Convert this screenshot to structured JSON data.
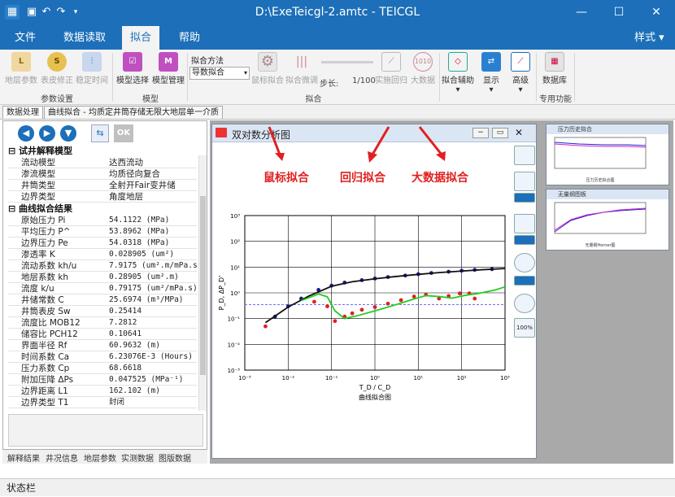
{
  "titlebar": {
    "title": "D:\\ExeTeicgl-2.amtc - TEICGL",
    "minimize": "—",
    "maximize": "☐",
    "close": "✕"
  },
  "menu": {
    "tabs": [
      "文件",
      "数据读取",
      "拟合",
      "帮助"
    ],
    "style": "样式"
  },
  "ribbon": {
    "params_group": {
      "label": "参数设置",
      "buttons": [
        "地层参数",
        "表皮修正",
        "稳定时间"
      ]
    },
    "model_group": {
      "label": "模型",
      "buttons": [
        "模型选择",
        "模型管理"
      ]
    },
    "fit_group": {
      "label": "拟合",
      "method_label": "拟合方法",
      "method_value": "导数拟合",
      "buttons": [
        "鼠标拟合",
        "拟合微调"
      ],
      "step_label": "步长:",
      "step_value": "1/100",
      "buttons2": [
        "实施回归",
        "大数据"
      ]
    },
    "assist": "拟合辅助",
    "display": "显示",
    "advanced": "高级",
    "database_group": {
      "label": "专用功能",
      "button": "数据库"
    }
  },
  "doc_tabs": [
    "数据处理",
    "曲线拟合 - 均质定井筒存储无限大地层单一介质"
  ],
  "left_panel": {
    "ok_label": "OK",
    "group1": "试井解释模型",
    "model_rows": [
      {
        "k": "流动模型",
        "v": "达西流动"
      },
      {
        "k": "渗流模型",
        "v": "均质径向复合"
      },
      {
        "k": "井筒类型",
        "v": "全射开Fair变井储"
      },
      {
        "k": "边界类型",
        "v": "角度地层"
      }
    ],
    "group2": "曲线拟合结果",
    "result_rows": [
      {
        "k": "原始压力 Pi",
        "v": "54.1122 (MPa)"
      },
      {
        "k": "平均压力 P^",
        "v": "53.8962 (MPa)"
      },
      {
        "k": "边界压力 Pe",
        "v": "54.0318 (MPa)"
      },
      {
        "k": "渗透率 K",
        "v": "0.028905 (um²)"
      },
      {
        "k": "流动系数 kh/u",
        "v": "7.9175 (um².m/mPa.s"
      },
      {
        "k": "地层系数 kh",
        "v": "0.28905 (um².m)"
      },
      {
        "k": "流度 k/u",
        "v": "0.79175 (um²/mPa.s)"
      },
      {
        "k": "井储常数 C",
        "v": "25.6974 (m³/MPa)"
      },
      {
        "k": "井筒表皮 Sw",
        "v": "0.25414"
      },
      {
        "k": "流度比 MOB12",
        "v": "7.2812"
      },
      {
        "k": "储容比 PCH12",
        "v": "0.10641"
      },
      {
        "k": "界面半径 Rf",
        "v": "60.9632 (m)"
      },
      {
        "k": "时间系数 Ca",
        "v": "6.23076E-3 (Hours)"
      },
      {
        "k": "压力系数 Cp",
        "v": "68.6618"
      },
      {
        "k": "附加压降 ΔPs",
        "v": "0.047525 (MPa⁻¹)"
      },
      {
        "k": "边界距离 L1",
        "v": "162.102 (m)"
      },
      {
        "k": "边界类型 T1",
        "v": "封闭"
      }
    ],
    "bottom_tabs": [
      "解释结果",
      "井况信息",
      "地层参数",
      "实测数据",
      "图版数据"
    ]
  },
  "chart_window": {
    "title": "双对数分析图"
  },
  "chart_data": {
    "type": "scatter",
    "xlabel": "T_D / C_D",
    "ylabel": "P_D, ΔP_D'",
    "caption": "曲线拟合图",
    "x_scale": "log",
    "y_scale": "log",
    "xlim": [
      0.001,
      1000
    ],
    "ylim": [
      0.001,
      1000
    ],
    "x_ticks": [
      "10⁻³",
      "10⁻²",
      "10⁻¹",
      "10⁰",
      "10¹",
      "10²",
      "10³"
    ],
    "y_ticks": [
      "10⁻³",
      "10⁻²",
      "10⁻¹",
      "10⁰",
      "10¹",
      "10²",
      "10³"
    ],
    "reference_line_y": 0.35,
    "series": [
      {
        "color": "#1b1b8f",
        "kind": "points",
        "x": [
          0.005,
          0.01,
          0.02,
          0.05,
          0.1,
          0.2,
          0.5,
          1,
          2,
          5,
          10,
          20,
          50,
          100,
          200,
          500
        ],
        "y": [
          0.12,
          0.3,
          0.6,
          1.3,
          1.9,
          2.5,
          3.1,
          3.6,
          4.1,
          4.7,
          5.3,
          5.9,
          6.6,
          7.2,
          7.8,
          8.3
        ]
      },
      {
        "color": "#111111",
        "kind": "line",
        "x": [
          0.003,
          0.01,
          0.03,
          0.1,
          0.3,
          1,
          3,
          10,
          30,
          100,
          300,
          1000
        ],
        "y": [
          0.07,
          0.28,
          0.75,
          1.8,
          2.7,
          3.5,
          4.3,
          5.2,
          6.1,
          7.0,
          7.9,
          8.8
        ]
      },
      {
        "color": "#e02020",
        "kind": "points",
        "x": [
          0.003,
          0.04,
          0.08,
          0.12,
          0.2,
          0.3,
          0.5,
          1,
          2,
          4,
          8,
          15,
          30,
          50,
          90,
          150,
          200
        ],
        "y": [
          0.05,
          0.45,
          0.3,
          0.08,
          0.12,
          0.16,
          0.22,
          0.28,
          0.38,
          0.52,
          0.72,
          0.85,
          0.6,
          0.75,
          0.95,
          0.95,
          0.6
        ]
      },
      {
        "color": "#22cc22",
        "kind": "line",
        "x": [
          0.02,
          0.05,
          0.08,
          0.12,
          0.2,
          0.4,
          1,
          2,
          4,
          8,
          15,
          30,
          60,
          120,
          250,
          600,
          1000
        ],
        "y": [
          0.5,
          0.9,
          0.7,
          0.2,
          0.1,
          0.13,
          0.2,
          0.28,
          0.4,
          0.58,
          0.78,
          0.72,
          0.62,
          0.8,
          0.95,
          1.3,
          1.7
        ]
      }
    ]
  },
  "annotations": [
    "鼠标拟合",
    "回归拟合",
    "大数据拟合"
  ],
  "thumbnails": [
    {
      "title": "压力历史拟合",
      "caption": "压力历史拟合图"
    },
    {
      "title": "无量纲图板",
      "caption": "无量纲Horner图"
    }
  ],
  "statusbar": {
    "text": "状态栏"
  }
}
